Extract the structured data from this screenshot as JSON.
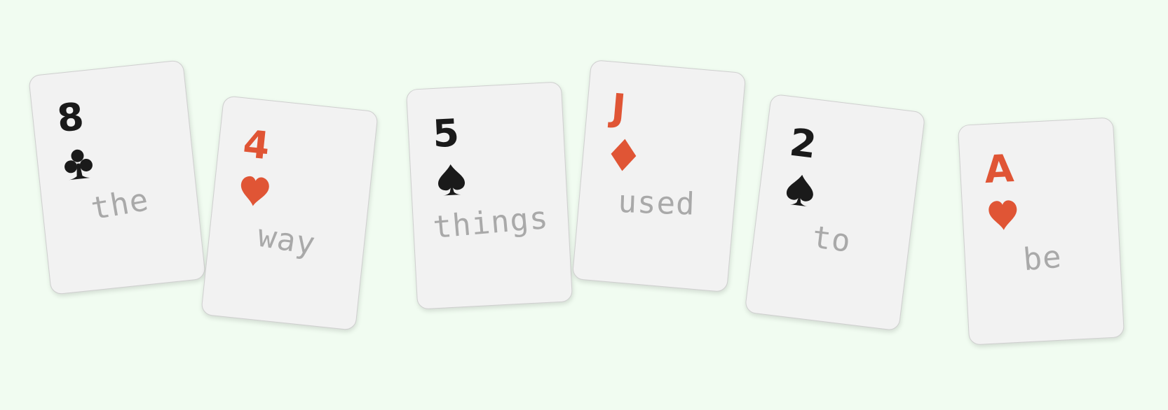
{
  "cards": [
    {
      "rank": "8",
      "suit": "club-icon",
      "word": "the",
      "color": "#1a1a1a"
    },
    {
      "rank": "4",
      "suit": "heart-icon",
      "word": "way",
      "color": "#e05535"
    },
    {
      "rank": "5",
      "suit": "spade-icon",
      "word": "things",
      "color": "#1a1a1a"
    },
    {
      "rank": "J",
      "suit": "diamond-icon",
      "word": "used",
      "color": "#e05535"
    },
    {
      "rank": "2",
      "suit": "spade-icon",
      "word": "to",
      "color": "#1a1a1a"
    },
    {
      "rank": "A",
      "suit": "heart-icon",
      "word": "be",
      "color": "#e05535"
    }
  ]
}
